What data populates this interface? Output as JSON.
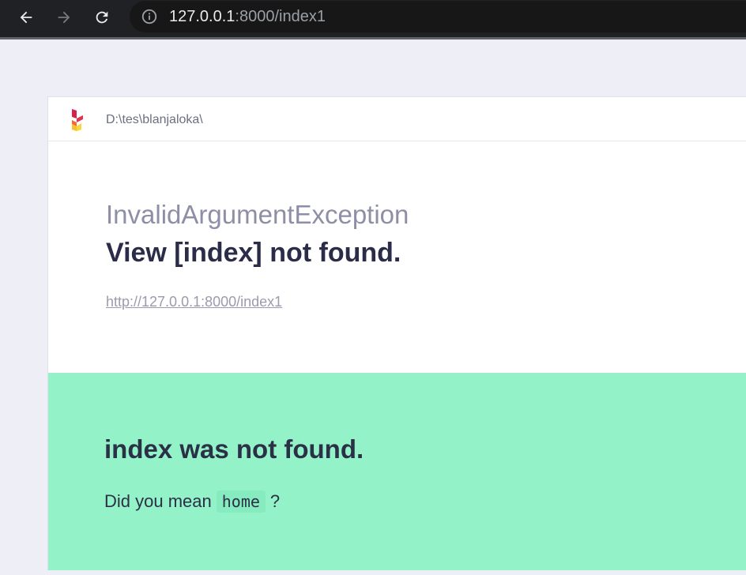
{
  "browser": {
    "back_icon": "arrow-left-icon",
    "forward_icon": "arrow-right-icon",
    "reload_icon": "reload-icon",
    "info_icon": "info-icon",
    "address_host": "127.0.0.1",
    "address_path": ":8000/index1"
  },
  "header": {
    "logo": "ignition-logo",
    "path": "D:\\tes\\blanjaloka\\"
  },
  "exception": {
    "class": "InvalidArgumentException",
    "message": "View [index] not found.",
    "url": "http://127.0.0.1:8000/index1"
  },
  "solution": {
    "title": "index was not found.",
    "text_before": "Did you mean",
    "suggestion": "home",
    "text_after": "?"
  },
  "colors": {
    "toolbar": "#202124",
    "page_bg": "#edeef6",
    "solution_bg": "#94f2c9",
    "heading": "#2b2d48"
  }
}
